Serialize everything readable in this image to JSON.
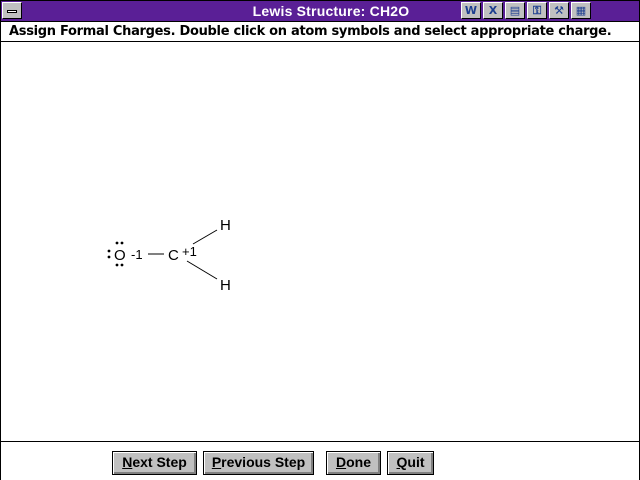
{
  "window": {
    "title": "Lewis Structure: CH2O",
    "toolbar_icons": [
      "w-icon",
      "x-icon",
      "disk-icon",
      "key-icon",
      "tools-icon",
      "clipboard-icon"
    ],
    "toolbar_glyphs": [
      "W",
      "X",
      "▤",
      "⚿",
      "⚒",
      "▦"
    ]
  },
  "instruction": "Assign Formal Charges.  Double click on atom symbols and select appropriate charge.",
  "molecule": {
    "oxygen": "O",
    "oxygen_charge": "-1",
    "carbon": "C",
    "carbon_charge": "+1",
    "hydrogen_top": "H",
    "hydrogen_bottom": "H"
  },
  "buttons": {
    "next_step": {
      "accel": "N",
      "rest": "ext Step"
    },
    "previous_step": {
      "accel": "P",
      "rest": "revious Step"
    },
    "done": {
      "accel": "D",
      "rest": "one"
    },
    "quit": {
      "accel": "Q",
      "rest": "uit"
    }
  }
}
